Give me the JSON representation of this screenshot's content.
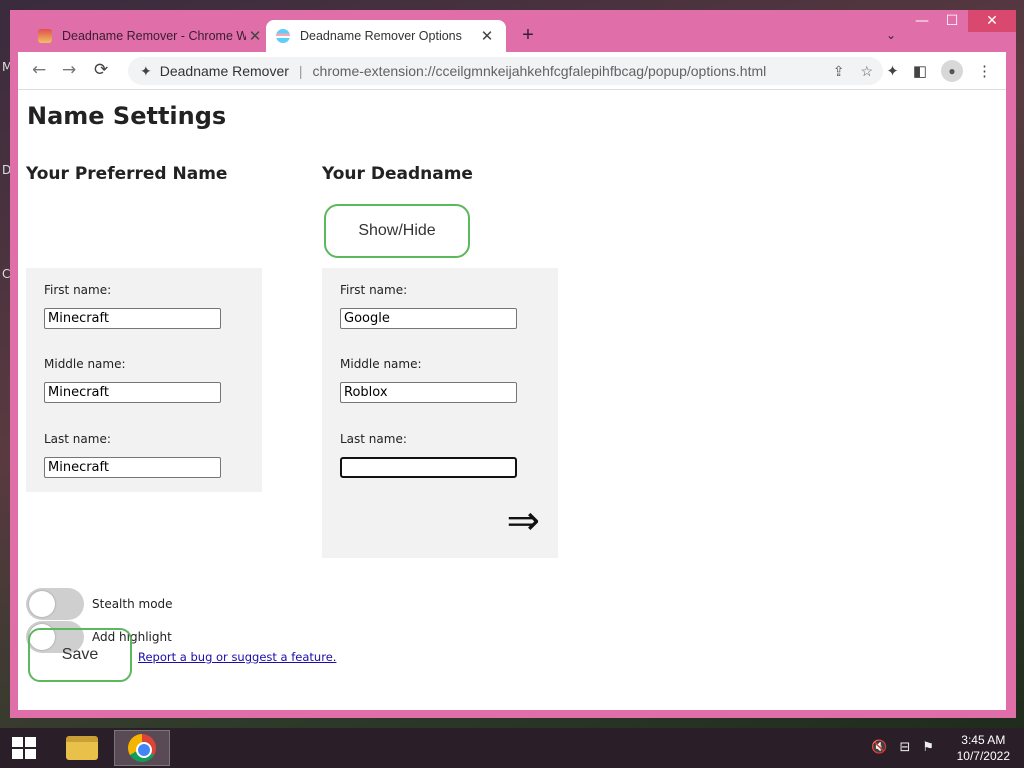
{
  "desktop": {
    "edge_letters": [
      "M",
      "D",
      "C"
    ]
  },
  "window_controls": {
    "minimize": "—",
    "maximize": "☐",
    "close": "✕"
  },
  "tabs": [
    {
      "title": "Deadname Remover - Chrome W",
      "close": "✕"
    },
    {
      "title": "Deadname Remover Options",
      "close": "✕"
    }
  ],
  "new_tab_label": "+",
  "tab_menu_label": "⌄",
  "nav": {
    "back": "←",
    "forward": "→",
    "reload": "⟳"
  },
  "omnibox": {
    "site_name": "Deadname Remover",
    "url": "chrome-extension://cceilgmnkeijahkehfcgfalepihfbcag/popup/options.html"
  },
  "page": {
    "title": "Name Settings",
    "preferred": {
      "heading": "Your Preferred Name",
      "first_label": "First name:",
      "first_value": "Minecraft",
      "middle_label": "Middle name:",
      "middle_value": "Minecraft",
      "last_label": "Last name:",
      "last_value": "Minecraft"
    },
    "deadname": {
      "heading": "Your Deadname",
      "show_hide_label": "Show/Hide",
      "first_label": "First name:",
      "first_value": "Google",
      "middle_label": "Middle name:",
      "middle_value": "Roblox",
      "last_label": "Last name:",
      "last_value": "",
      "arrow": "⇒"
    },
    "stealth_label": "Stealth mode",
    "stealth_on": false,
    "highlight_label": "Add highlight",
    "highlight_on": false,
    "save_label": "Save",
    "report_link": "Report a bug or suggest a feature."
  },
  "taskbar": {
    "time": "3:45 AM",
    "date": "10/7/2022"
  },
  "colors": {
    "frame": "#e06ea8",
    "accent_green": "#5cb85c",
    "panel_bg": "#f2f2f2"
  }
}
